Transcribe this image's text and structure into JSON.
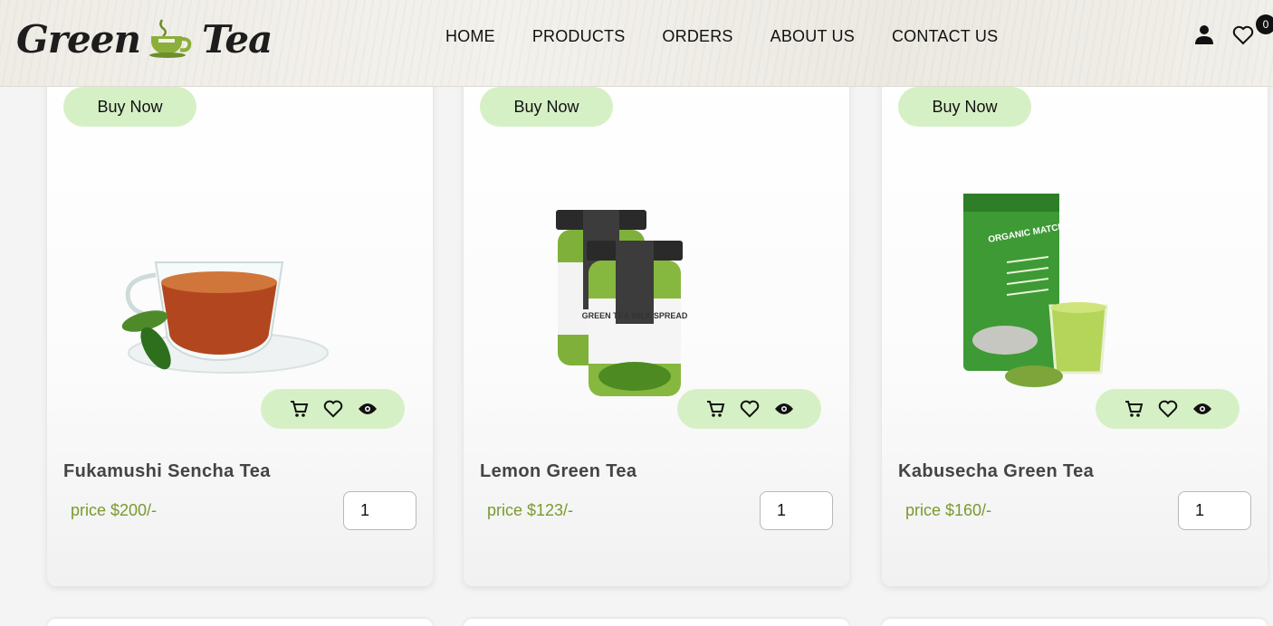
{
  "brand": {
    "logo_left": "Green",
    "logo_right": "Tea"
  },
  "nav": {
    "items": [
      "HOME",
      "PRODUCTS",
      "ORDERS",
      "ABOUT US",
      "CONTACT US"
    ]
  },
  "header": {
    "wishlist_count": "0"
  },
  "colors": {
    "accent_green": "#d6f0c5",
    "price_green": "#7a9a2e",
    "text_dark": "#111111"
  },
  "products": [
    {
      "buy_label": "Buy Now",
      "name": "Fukamushi Sencha Tea",
      "price": "price $200/-",
      "qty": "1",
      "image": "tea-cup-image"
    },
    {
      "buy_label": "Buy Now",
      "name": "Lemon Green Tea",
      "price": "price $123/-",
      "qty": "1",
      "image": "green-tea-spread-jars-image",
      "jar_label": "GREEN TEA MILK SPREAD"
    },
    {
      "buy_label": "Buy Now",
      "name": "Kabusecha Green Tea",
      "price": "price $160/-",
      "qty": "1",
      "image": "matcha-pouch-image",
      "pouch_label": "ORGANIC MATCHA"
    }
  ],
  "icons": [
    "cart-icon",
    "heart-icon",
    "eye-icon",
    "user-icon",
    "cup-logo-icon"
  ]
}
